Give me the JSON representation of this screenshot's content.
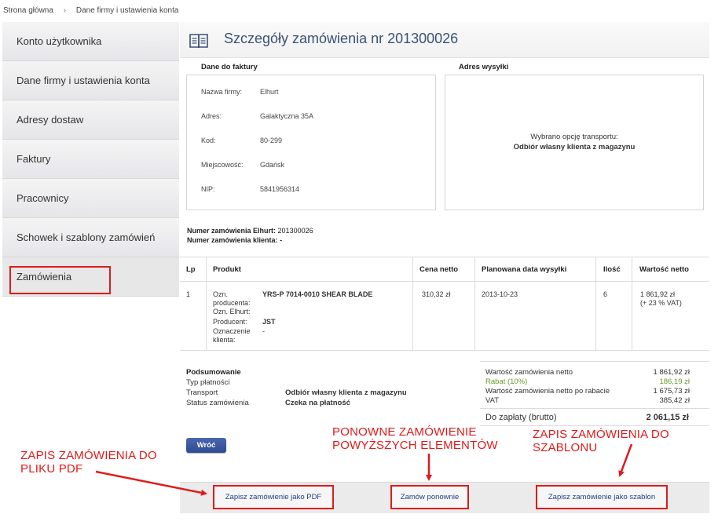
{
  "breadcrumb": {
    "home": "Strona główna",
    "separator": "›",
    "current": "Dane firmy i ustawienia konta"
  },
  "sidebar": {
    "items": [
      {
        "label": "Konto użytkownika"
      },
      {
        "label": "Dane firmy i ustawienia konta"
      },
      {
        "label": "Adresy dostaw"
      },
      {
        "label": "Faktury"
      },
      {
        "label": "Pracownicy"
      },
      {
        "label": "Schowek i szablony zamówień"
      },
      {
        "label": "Zamówienia"
      }
    ]
  },
  "header": {
    "title": "Szczegóły zamówienia nr 201300026",
    "icon": "book-icon"
  },
  "invoice": {
    "label": "Dane do faktury",
    "fields": [
      {
        "key": "Nazwa firmy:",
        "value": "Elhurt"
      },
      {
        "key": "Adres:",
        "value": "Galaktyczna 35A"
      },
      {
        "key": "Kod:",
        "value": "80-299"
      },
      {
        "key": "Miejscowość:",
        "value": "Gdańsk"
      },
      {
        "key": "NIP:",
        "value": "5841956314"
      }
    ]
  },
  "shipping": {
    "label": "Adres wysyłki",
    "line1": "Wybrano opcję transportu:",
    "line2": "Odbiór własny klienta z magazynu"
  },
  "order_numbers": {
    "elhurt_label": "Numer zamówienia Elhurt:",
    "elhurt_value": "201300026",
    "client_label": "Numer zamówienia klienta:",
    "client_value": "-"
  },
  "table": {
    "headers": {
      "lp": "Lp",
      "product": "Produkt",
      "price": "Cena netto",
      "date": "Planowana data wysyłki",
      "qty": "Ilość",
      "value": "Wartość netto"
    },
    "row": {
      "lp": "1",
      "labels": [
        "Ozn. producenta:",
        "Ozn. Elhurt:",
        "Producent:",
        "Oznaczenie klienta:"
      ],
      "producer_code": "YRS-P 7014-0010 SHEAR BLADE",
      "elhurt_code": "",
      "producer": "JST",
      "client_code": "-",
      "price": "310,32 zł",
      "date": "2013-10-23",
      "qty": "6",
      "value": "1 861,92 zł",
      "vat": "(+ 23 % VAT)"
    }
  },
  "summary": {
    "title": "Podsumowanie",
    "payment_label": "Typ płatności",
    "payment_value": "",
    "transport_label": "Transport",
    "transport_value": "Odbiór własny klienta z magazynu",
    "status_label": "Status zamówienia",
    "status_value": "Czeka na płatność"
  },
  "totals": {
    "net_label": "Wartość zamówienia netto",
    "net_value": "1 861,92 zł",
    "discount_label": "Rabat (10%)",
    "discount_value": "186,19 zł",
    "after_discount_label": "Wartość zamówienia netto po rabacie",
    "after_discount_value": "1 675,73 zł",
    "vat_label": "VAT",
    "vat_value": "385,42 zł",
    "gross_label": "Do zapłaty (brutto)",
    "gross_value": "2 061,15 zł"
  },
  "buttons": {
    "back": "Wróć",
    "save_pdf": "Zapisz zamówienie jako PDF",
    "reorder": "Zamów ponownie",
    "save_template": "Zapisz zamówienie jako szablon"
  },
  "annotations": {
    "pdf": [
      "ZAPIS ZAMÓWIENIA DO",
      "PLIKU PDF"
    ],
    "reorder": [
      "PONOWNE ZAMÓWIENIE",
      "POWYŻSZYCH ELEMENTÓW"
    ],
    "template": [
      "ZAPIS ZAMÓWIENIA DO",
      "SZABLONU"
    ]
  },
  "colors": {
    "accent": "#3b5277",
    "annotation": "#e01a1a",
    "button": "#2d4a93",
    "discount": "#6a9a2a"
  }
}
